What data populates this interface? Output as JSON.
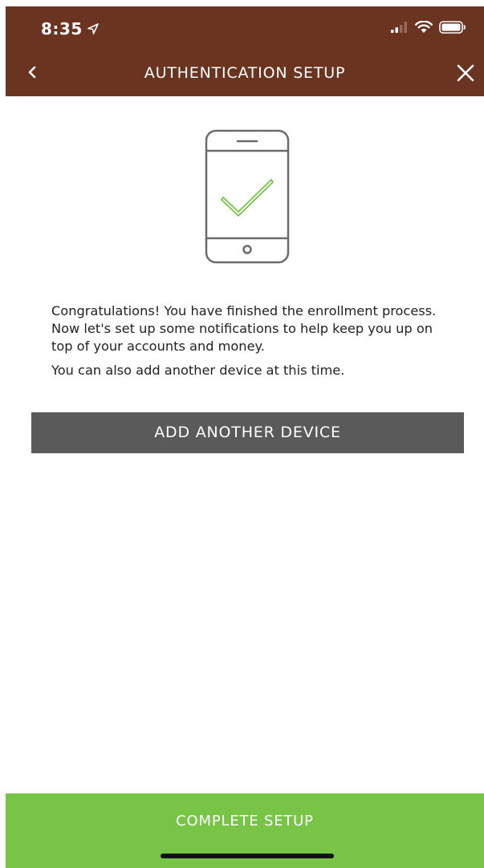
{
  "status_bar": {
    "time": "8:35",
    "icons": [
      "location-arrow-icon",
      "cellular-signal-icon",
      "wifi-icon",
      "battery-icon"
    ]
  },
  "nav": {
    "back_icon": "chevron-left-icon",
    "title": "AUTHENTICATION SETUP",
    "close_icon": "close-icon"
  },
  "illustration": {
    "icon": "phone-checkmark-icon",
    "outline_color": "#6b6b6b",
    "check_color": "#77c446"
  },
  "message": {
    "paragraph_1": "Congratulations! You have finished the enrollment process. Now let's set up some notifications to help keep you up on top of your accounts and money.",
    "paragraph_2": "You can also add another device at this time."
  },
  "buttons": {
    "add_device_label": "ADD ANOTHER DEVICE",
    "complete_label": "COMPLETE SETUP"
  },
  "colors": {
    "header_brown": "#6b3421",
    "button_gray": "#5a5a5a",
    "accent_green": "#77c446"
  }
}
